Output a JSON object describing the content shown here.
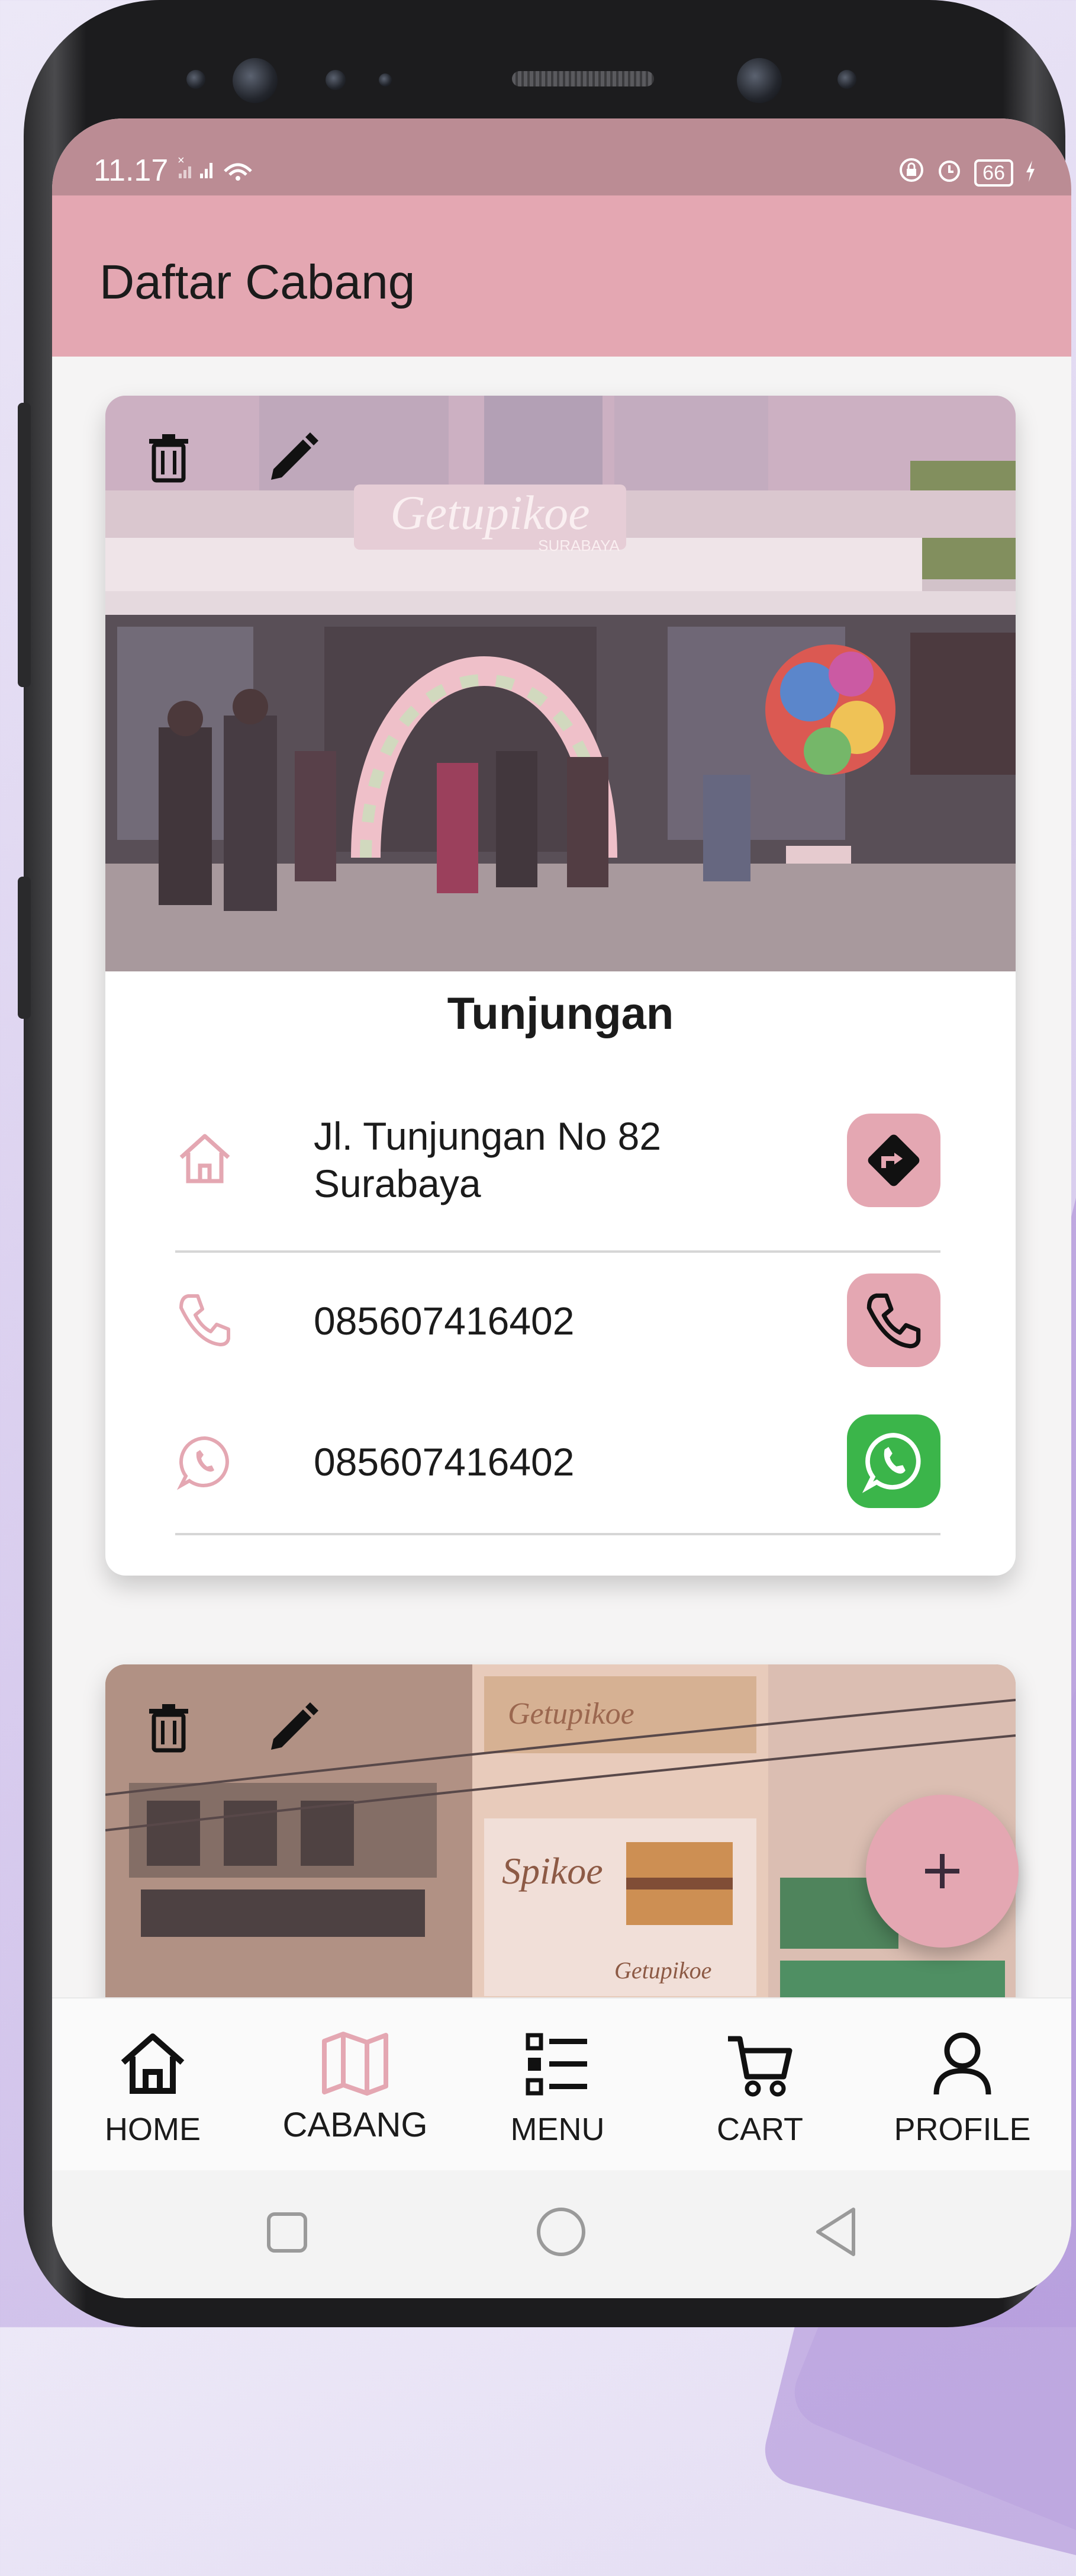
{
  "status_bar": {
    "time": "11.17",
    "signal_label": "×",
    "battery": "66"
  },
  "app_bar": {
    "title": "Daftar Cabang"
  },
  "branches": [
    {
      "name": "Tunjungan",
      "address_line1": "Jl. Tunjungan No 82",
      "address_line2": "Surabaya",
      "phone": "085607416402",
      "whatsapp": "085607416402",
      "sign_text": "Getupikoe",
      "sign_subtext": "SURABAYA"
    },
    {
      "billboard_text": "Spikoe",
      "billboard_brand": "Getupikoe"
    }
  ],
  "fab": {
    "icon": "plus-icon"
  },
  "bottom_nav": {
    "items": [
      {
        "label": "HOME",
        "icon": "home-icon",
        "active": false
      },
      {
        "label": "CABANG",
        "icon": "map-icon",
        "active": true
      },
      {
        "label": "MENU",
        "icon": "list-icon",
        "active": false
      },
      {
        "label": "CART",
        "icon": "cart-icon",
        "active": false
      },
      {
        "label": "PROFILE",
        "icon": "person-icon",
        "active": false
      }
    ]
  },
  "colors": {
    "primary": "#e4a7b2",
    "status_bar": "#bb8c94",
    "whatsapp": "#3bb54a",
    "active_nav": "#e4a7b2"
  }
}
